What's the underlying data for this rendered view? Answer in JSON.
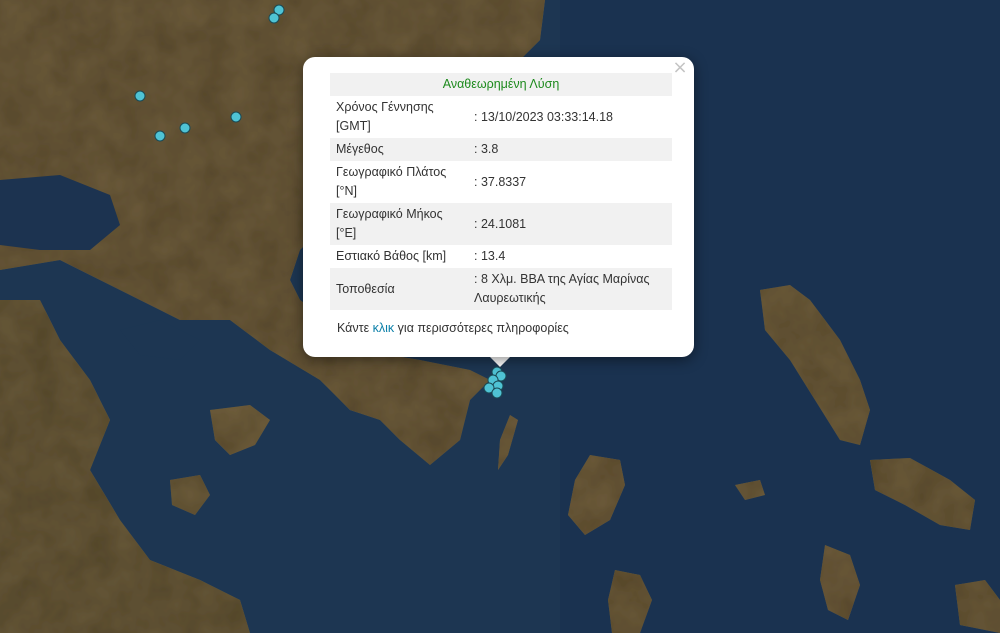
{
  "popup": {
    "title": "Αναθεωρημένη Λύση",
    "close_symbol": "×",
    "rows": [
      {
        "label": "Χρόνος Γέννησης [GMT]",
        "value": ": 13/10/2023 03:33:14.18"
      },
      {
        "label": "Μέγεθος",
        "value": ": 3.8"
      },
      {
        "label": "Γεωγραφικό Πλάτος [°N]",
        "value": ": 37.8337"
      },
      {
        "label": "Γεωγραφικό Μήκος [°E]",
        "value": ": 24.1081"
      },
      {
        "label": "Εστιακό Βάθος [km]",
        "value": ": 13.4"
      },
      {
        "label": "Τοποθεσία",
        "value": ": 8 Χλμ. ΒΒΑ της Αγίας Μαρίνας Λαυρεωτικής"
      }
    ],
    "more_prefix": "Κάντε ",
    "more_link": "κλικ",
    "more_suffix": " για περισσότερες πληροφορίες"
  },
  "colors": {
    "sea": "#1d3652",
    "land": "#6b5a3a",
    "marker": "#4fc3d4",
    "title_green": "#1d8a1d",
    "link": "#0a7fa8"
  },
  "map": {
    "icon": "earthquake-marker-icon",
    "markers": [
      {
        "name": "epicenter-marker"
      },
      {
        "name": "epicenter-marker"
      },
      {
        "name": "epicenter-marker"
      },
      {
        "name": "epicenter-marker"
      },
      {
        "name": "epicenter-marker"
      },
      {
        "name": "epicenter-marker"
      },
      {
        "name": "epicenter-marker"
      },
      {
        "name": "epicenter-marker"
      },
      {
        "name": "epicenter-marker"
      },
      {
        "name": "epicenter-marker"
      },
      {
        "name": "epicenter-marker"
      },
      {
        "name": "epicenter-marker"
      }
    ]
  }
}
